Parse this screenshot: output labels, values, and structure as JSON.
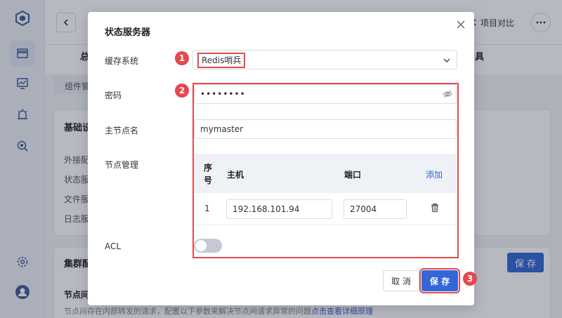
{
  "header": {
    "compare_label": "项目对比",
    "tab_frag_left": "总",
    "tab_frag_right": "具"
  },
  "background": {
    "subtab_label": "组件管",
    "card1": {
      "title": "基础设",
      "items": [
        "外接配",
        "状态服",
        "文件服",
        "日志服"
      ]
    },
    "card2": {
      "title": "集群配",
      "subtitle": "节点间",
      "desc_text": "节点间存在内部转发的请求，配置以下参数来解决节点间请求异常的问题",
      "desc_link": "点击查看详细原理",
      "save_label": "保 存"
    }
  },
  "modal": {
    "title": "状态服务器",
    "cache_label": "缓存系统",
    "cache_value": "Redis哨兵",
    "password_label": "密码",
    "password_value": "••••••••",
    "master_label": "主节点名",
    "master_value": "mymaster",
    "nodes_label": "节点管理",
    "table": {
      "headers": {
        "seq": "序号",
        "host": "主机",
        "port": "端口",
        "add": "添加"
      },
      "rows": [
        {
          "seq": "1",
          "host": "192.168.101.94",
          "port": "27004"
        }
      ]
    },
    "acl_label": "ACL",
    "acl_enabled": false,
    "cancel_label": "取 消",
    "save_label": "保 存"
  },
  "markers": [
    "1",
    "2",
    "3"
  ],
  "colors": {
    "primary": "#3366d6",
    "annotation_red": "#e5484d"
  },
  "icons": [
    "logo-icon",
    "list-icon",
    "chart-icon",
    "alarm-icon",
    "search-doc-icon",
    "settings-icon",
    "user-icon",
    "back-icon",
    "compare-icon",
    "more-icon",
    "close-icon",
    "chevron-down-icon",
    "eye-off-icon",
    "trash-icon"
  ]
}
